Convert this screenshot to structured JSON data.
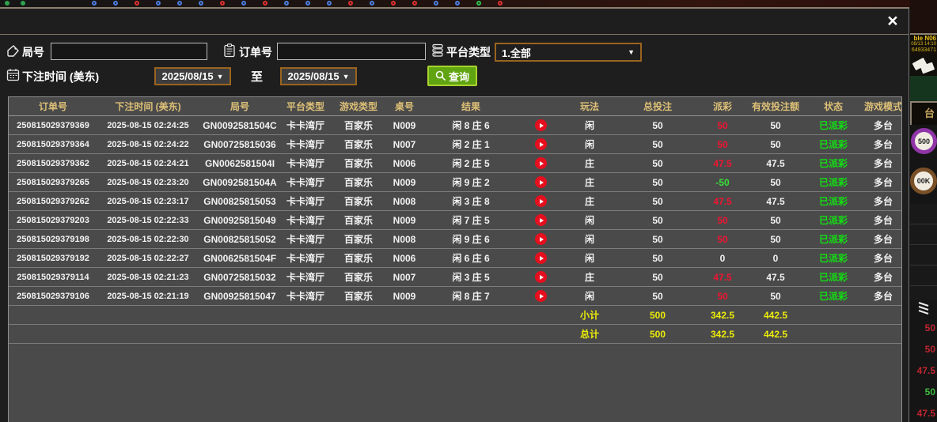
{
  "background": {
    "left_beads": [
      "solid",
      "solid"
    ],
    "road_beads": [
      "blue",
      "blue",
      "red",
      "blue",
      "blue",
      "blue",
      "red",
      "blue",
      "red",
      "blue",
      "blue",
      "blue",
      "red",
      "blue",
      "red",
      "red",
      "blue",
      "blue",
      "green",
      "red"
    ],
    "right_strip": {
      "table_name": "ble N06",
      "session_time": "08/13 14:10",
      "session_id": "64933471",
      "tab_char": "台",
      "chip_small": "500",
      "chip_big": "00K",
      "history_numbers": [
        {
          "text": "50",
          "color": "red"
        },
        {
          "text": "50",
          "color": "red"
        },
        {
          "text": "47.5",
          "color": "red"
        },
        {
          "text": "50",
          "color": "green"
        },
        {
          "text": "47.5",
          "color": "red"
        }
      ]
    }
  },
  "modal": {
    "close_label": "×",
    "filters": {
      "round_no": {
        "label": "局号",
        "value": ""
      },
      "order_no": {
        "label": "订单号",
        "value": ""
      },
      "platform": {
        "label": "平台类型",
        "selected": "1.全部",
        "arrow": "▼"
      },
      "bet_time": {
        "label": "下注时间 (美东)",
        "from": "2025/08/15",
        "to_word": "至",
        "to": "2025/08/15",
        "arrow": "▼"
      },
      "search_label": "查询"
    },
    "table": {
      "headers": [
        "订单号",
        "下注时间 (美东)",
        "局号",
        "平台类型",
        "游戏类型",
        "桌号",
        "结果",
        "",
        "玩法",
        "总投注",
        "派彩",
        "有效投注额",
        "状态",
        "游戏模式"
      ],
      "rows": [
        {
          "order_id": "250815029379369",
          "bet_time": "2025-08-15 02:24:25",
          "round_id": "GN0092581504C",
          "platform": "卡卡湾厅",
          "game_type": "百家乐",
          "table_no": "N009",
          "result": "闲 8 庄 6",
          "play": "闲",
          "total_bet": "50",
          "payout": "50",
          "payout_class": "red",
          "valid_bet": "50",
          "status": "已派彩",
          "mode": "多台"
        },
        {
          "order_id": "250815029379364",
          "bet_time": "2025-08-15 02:24:22",
          "round_id": "GN00725815036",
          "platform": "卡卡湾厅",
          "game_type": "百家乐",
          "table_no": "N007",
          "result": "闲 2 庄 1",
          "play": "闲",
          "total_bet": "50",
          "payout": "50",
          "payout_class": "red",
          "valid_bet": "50",
          "status": "已派彩",
          "mode": "多台"
        },
        {
          "order_id": "250815029379362",
          "bet_time": "2025-08-15 02:24:21",
          "round_id": "GN0062581504I",
          "platform": "卡卡湾厅",
          "game_type": "百家乐",
          "table_no": "N006",
          "result": "闲 2 庄 5",
          "play": "庄",
          "total_bet": "50",
          "payout": "47.5",
          "payout_class": "red",
          "valid_bet": "47.5",
          "status": "已派彩",
          "mode": "多台"
        },
        {
          "order_id": "250815029379265",
          "bet_time": "2025-08-15 02:23:20",
          "round_id": "GN0092581504A",
          "platform": "卡卡湾厅",
          "game_type": "百家乐",
          "table_no": "N009",
          "result": "闲 9 庄 2",
          "play": "庄",
          "total_bet": "50",
          "payout": "-50",
          "payout_class": "green",
          "valid_bet": "50",
          "status": "已派彩",
          "mode": "多台"
        },
        {
          "order_id": "250815029379262",
          "bet_time": "2025-08-15 02:23:17",
          "round_id": "GN00825815053",
          "platform": "卡卡湾厅",
          "game_type": "百家乐",
          "table_no": "N008",
          "result": "闲 3 庄 8",
          "play": "庄",
          "total_bet": "50",
          "payout": "47.5",
          "payout_class": "red",
          "valid_bet": "47.5",
          "status": "已派彩",
          "mode": "多台"
        },
        {
          "order_id": "250815029379203",
          "bet_time": "2025-08-15 02:22:33",
          "round_id": "GN00925815049",
          "platform": "卡卡湾厅",
          "game_type": "百家乐",
          "table_no": "N009",
          "result": "闲 7 庄 5",
          "play": "闲",
          "total_bet": "50",
          "payout": "50",
          "payout_class": "red",
          "valid_bet": "50",
          "status": "已派彩",
          "mode": "多台"
        },
        {
          "order_id": "250815029379198",
          "bet_time": "2025-08-15 02:22:30",
          "round_id": "GN00825815052",
          "platform": "卡卡湾厅",
          "game_type": "百家乐",
          "table_no": "N008",
          "result": "闲 9 庄 6",
          "play": "闲",
          "total_bet": "50",
          "payout": "50",
          "payout_class": "red",
          "valid_bet": "50",
          "status": "已派彩",
          "mode": "多台"
        },
        {
          "order_id": "250815029379192",
          "bet_time": "2025-08-15 02:22:27",
          "round_id": "GN0062581504F",
          "platform": "卡卡湾厅",
          "game_type": "百家乐",
          "table_no": "N006",
          "result": "闲 6 庄 6",
          "play": "闲",
          "total_bet": "50",
          "payout": "0",
          "payout_class": "white",
          "valid_bet": "0",
          "status": "已派彩",
          "mode": "多台"
        },
        {
          "order_id": "250815029379114",
          "bet_time": "2025-08-15 02:21:23",
          "round_id": "GN00725815032",
          "platform": "卡卡湾厅",
          "game_type": "百家乐",
          "table_no": "N007",
          "result": "闲 3 庄 5",
          "play": "庄",
          "total_bet": "50",
          "payout": "47.5",
          "payout_class": "red",
          "valid_bet": "47.5",
          "status": "已派彩",
          "mode": "多台"
        },
        {
          "order_id": "250815029379106",
          "bet_time": "2025-08-15 02:21:19",
          "round_id": "GN00925815047",
          "platform": "卡卡湾厅",
          "game_type": "百家乐",
          "table_no": "N009",
          "result": "闲 8 庄 7",
          "play": "闲",
          "total_bet": "50",
          "payout": "50",
          "payout_class": "red",
          "valid_bet": "50",
          "status": "已派彩",
          "mode": "多台"
        }
      ],
      "subtotal": {
        "label": "小计",
        "total_bet": "500",
        "payout": "342.5",
        "valid_bet": "442.5"
      },
      "grand_total": {
        "label": "总计",
        "total_bet": "500",
        "payout": "342.5",
        "valid_bet": "442.5"
      }
    }
  }
}
